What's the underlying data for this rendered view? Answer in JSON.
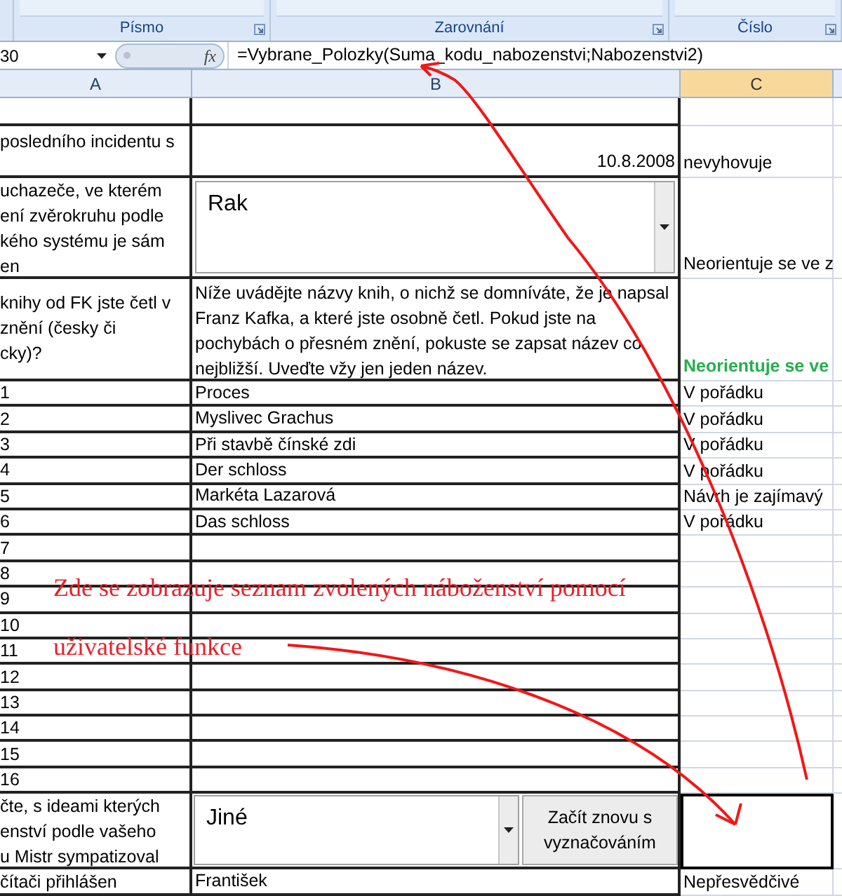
{
  "ribbon_groups": [
    {
      "label": "Písmo"
    },
    {
      "label": "Zarovnání"
    },
    {
      "label": "Číslo"
    }
  ],
  "formula_bar": {
    "name_box": "30",
    "fx_label": "fx",
    "formula": "=Vybrane_Polozky(Suma_kodu_nabozenstvi;Nabozenstvi2)"
  },
  "columns": [
    {
      "label": "A",
      "selected": false
    },
    {
      "label": "B",
      "selected": false
    },
    {
      "label": "C",
      "selected": true
    }
  ],
  "rows": [
    {
      "kind": "blank"
    },
    {
      "kind": "date",
      "a_lines": [
        "posledního incidentu s"
      ],
      "b": "10.8.2008",
      "c": "nevyhovuje"
    },
    {
      "kind": "combo",
      "a_lines": [
        "uchazeče, ve kterém",
        "ení zvěrokruhu podle",
        "kého systému je sám",
        "en"
      ],
      "combo": "Rak",
      "c": "Neorientuje se ve z"
    },
    {
      "kind": "note",
      "a_lines": [
        "knihy od FK jste četl v",
        "znění (česky či",
        "cky)?"
      ],
      "b": "Níže uvádějte názvy knih, o nichž se domníváte, že je napsal Franz Kafka, a které jste osobně četl. Pokud jste na pochybách o přesném znění, pokuste se zapsat název co nejbližší. Uveďte vžy jen jeden název.",
      "c": "Neorientuje se ve",
      "color": "#22b04b"
    },
    {
      "kind": "item",
      "number": "1",
      "b": "Proces",
      "c": "V pořádku"
    },
    {
      "kind": "item",
      "number": "2",
      "b": "Myslivec Grachus",
      "c": "V pořádku"
    },
    {
      "kind": "item",
      "number": "3",
      "b": "Při stavbě čínské zdi",
      "c": "V pořádku"
    },
    {
      "kind": "item",
      "number": "4",
      "b": "Der schloss",
      "c": "V pořádku"
    },
    {
      "kind": "item",
      "number": "5",
      "b": "Markéta Lazarová",
      "c": "Návrh je zajímavý"
    },
    {
      "kind": "item",
      "number": "6",
      "b": "Das schloss",
      "c": "V pořádku"
    },
    {
      "kind": "item",
      "number": "7"
    },
    {
      "kind": "item",
      "number": "8"
    },
    {
      "kind": "item",
      "number": "9"
    },
    {
      "kind": "item",
      "number": "10"
    },
    {
      "kind": "item",
      "number": "11"
    },
    {
      "kind": "item",
      "number": "12"
    },
    {
      "kind": "item",
      "number": "13"
    },
    {
      "kind": "item",
      "number": "14"
    },
    {
      "kind": "item",
      "number": "15"
    },
    {
      "kind": "item",
      "number": "16"
    },
    {
      "kind": "combo_button",
      "a_lines": [
        "čte, s ideami kterých",
        "enství podle vašeho",
        "u Mistr sympatizoval"
      ],
      "combo": "Jiné",
      "button": "Začít znovu s vyznačováním",
      "selected": true
    },
    {
      "kind": "plain",
      "a_lines": [
        "čítači přihlášen"
      ],
      "b": "František",
      "c": "Nepřesvědčivé"
    }
  ],
  "annotation": {
    "lines": [
      "Zde se zobrazuje seznam zvolených náboženství pomocí",
      "uživatelské funkce"
    ]
  }
}
